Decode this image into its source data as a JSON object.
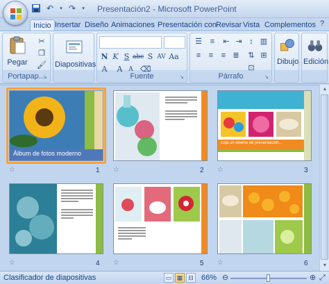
{
  "window": {
    "title": "Presentación2 - Microsoft PowerPoint",
    "qat_icons": [
      "save-icon",
      "undo-icon",
      "redo-icon",
      "customize-icon"
    ],
    "help_glyph": "?"
  },
  "tabs": [
    {
      "label": "Inicio",
      "active": true
    },
    {
      "label": "Insertar"
    },
    {
      "label": "Diseño"
    },
    {
      "label": "Animaciones"
    },
    {
      "label": "Presentación con"
    },
    {
      "label": "Revisar"
    },
    {
      "label": "Vista"
    },
    {
      "label": "Complementos"
    }
  ],
  "ribbon": {
    "portapapeles": {
      "label": "Portapap...",
      "paste_label": "Pegar"
    },
    "diapositivas": {
      "label": "Diapositivas"
    },
    "fuente": {
      "label": "Fuente"
    },
    "parrafo": {
      "label": "Párrafo"
    },
    "dibujo": {
      "label": "Dibujo"
    },
    "edicion": {
      "label": "Edición"
    }
  },
  "slides": [
    {
      "number": "1",
      "title": "Álbum de fotos moderno",
      "selected": true
    },
    {
      "number": "2"
    },
    {
      "number": "3",
      "caption": "Elija un diseño de presentación..."
    },
    {
      "number": "4"
    },
    {
      "number": "5"
    },
    {
      "number": "6"
    }
  ],
  "status": {
    "view_label": "Clasificador de diapositivas",
    "zoom": "66%",
    "zoom_fraction": 0.5
  }
}
